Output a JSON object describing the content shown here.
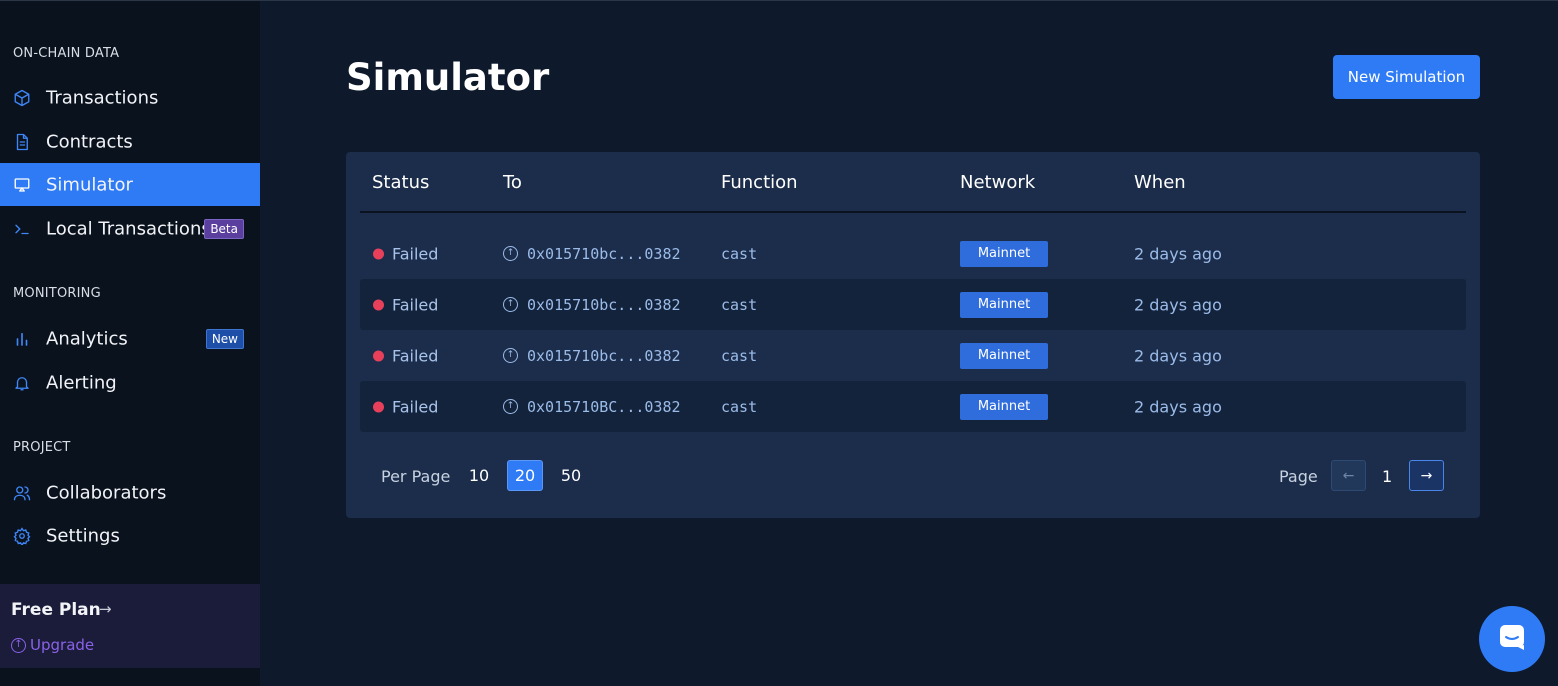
{
  "sidebar": {
    "sections": [
      {
        "title": "ON-CHAIN DATA"
      },
      {
        "title": "MONITORING"
      },
      {
        "title": "PROJECT"
      }
    ],
    "items": [
      {
        "label": "Transactions",
        "icon": "cube-icon"
      },
      {
        "label": "Contracts",
        "icon": "document-icon"
      },
      {
        "label": "Simulator",
        "icon": "monitor-icon",
        "active": true
      },
      {
        "label": "Local Transactions",
        "icon": "terminal-icon",
        "badge": "Beta"
      },
      {
        "label": "Analytics",
        "icon": "bar-chart-icon",
        "badge": "New"
      },
      {
        "label": "Alerting",
        "icon": "bell-icon"
      },
      {
        "label": "Collaborators",
        "icon": "users-icon"
      },
      {
        "label": "Settings",
        "icon": "gear-icon"
      }
    ],
    "plan": {
      "title": "Free Plan",
      "upgrade_label": "Upgrade"
    }
  },
  "main": {
    "title": "Simulator",
    "new_button_label": "New Simulation",
    "table": {
      "columns": [
        "Status",
        "To",
        "Function",
        "Network",
        "When"
      ],
      "rows": [
        {
          "status": "Failed",
          "to": "0x015710bc...0382",
          "function": "cast",
          "network": "Mainnet",
          "when": "2 days ago"
        },
        {
          "status": "Failed",
          "to": "0x015710bc...0382",
          "function": "cast",
          "network": "Mainnet",
          "when": "2 days ago"
        },
        {
          "status": "Failed",
          "to": "0x015710bc...0382",
          "function": "cast",
          "network": "Mainnet",
          "when": "2 days ago"
        },
        {
          "status": "Failed",
          "to": "0x015710BC...0382",
          "function": "cast",
          "network": "Mainnet",
          "when": "2 days ago"
        }
      ]
    },
    "pagination": {
      "per_page_label": "Per Page",
      "per_page_options": [
        "10",
        "20",
        "50"
      ],
      "per_page_selected": "20",
      "page_label": "Page",
      "current_page": "1"
    }
  },
  "colors": {
    "accent": "#2f7bf5",
    "status_failed": "#e8405a",
    "sidebar_bg": "#0a121e",
    "main_bg": "#0e1a2c",
    "card_bg": "#1b2d4b"
  }
}
